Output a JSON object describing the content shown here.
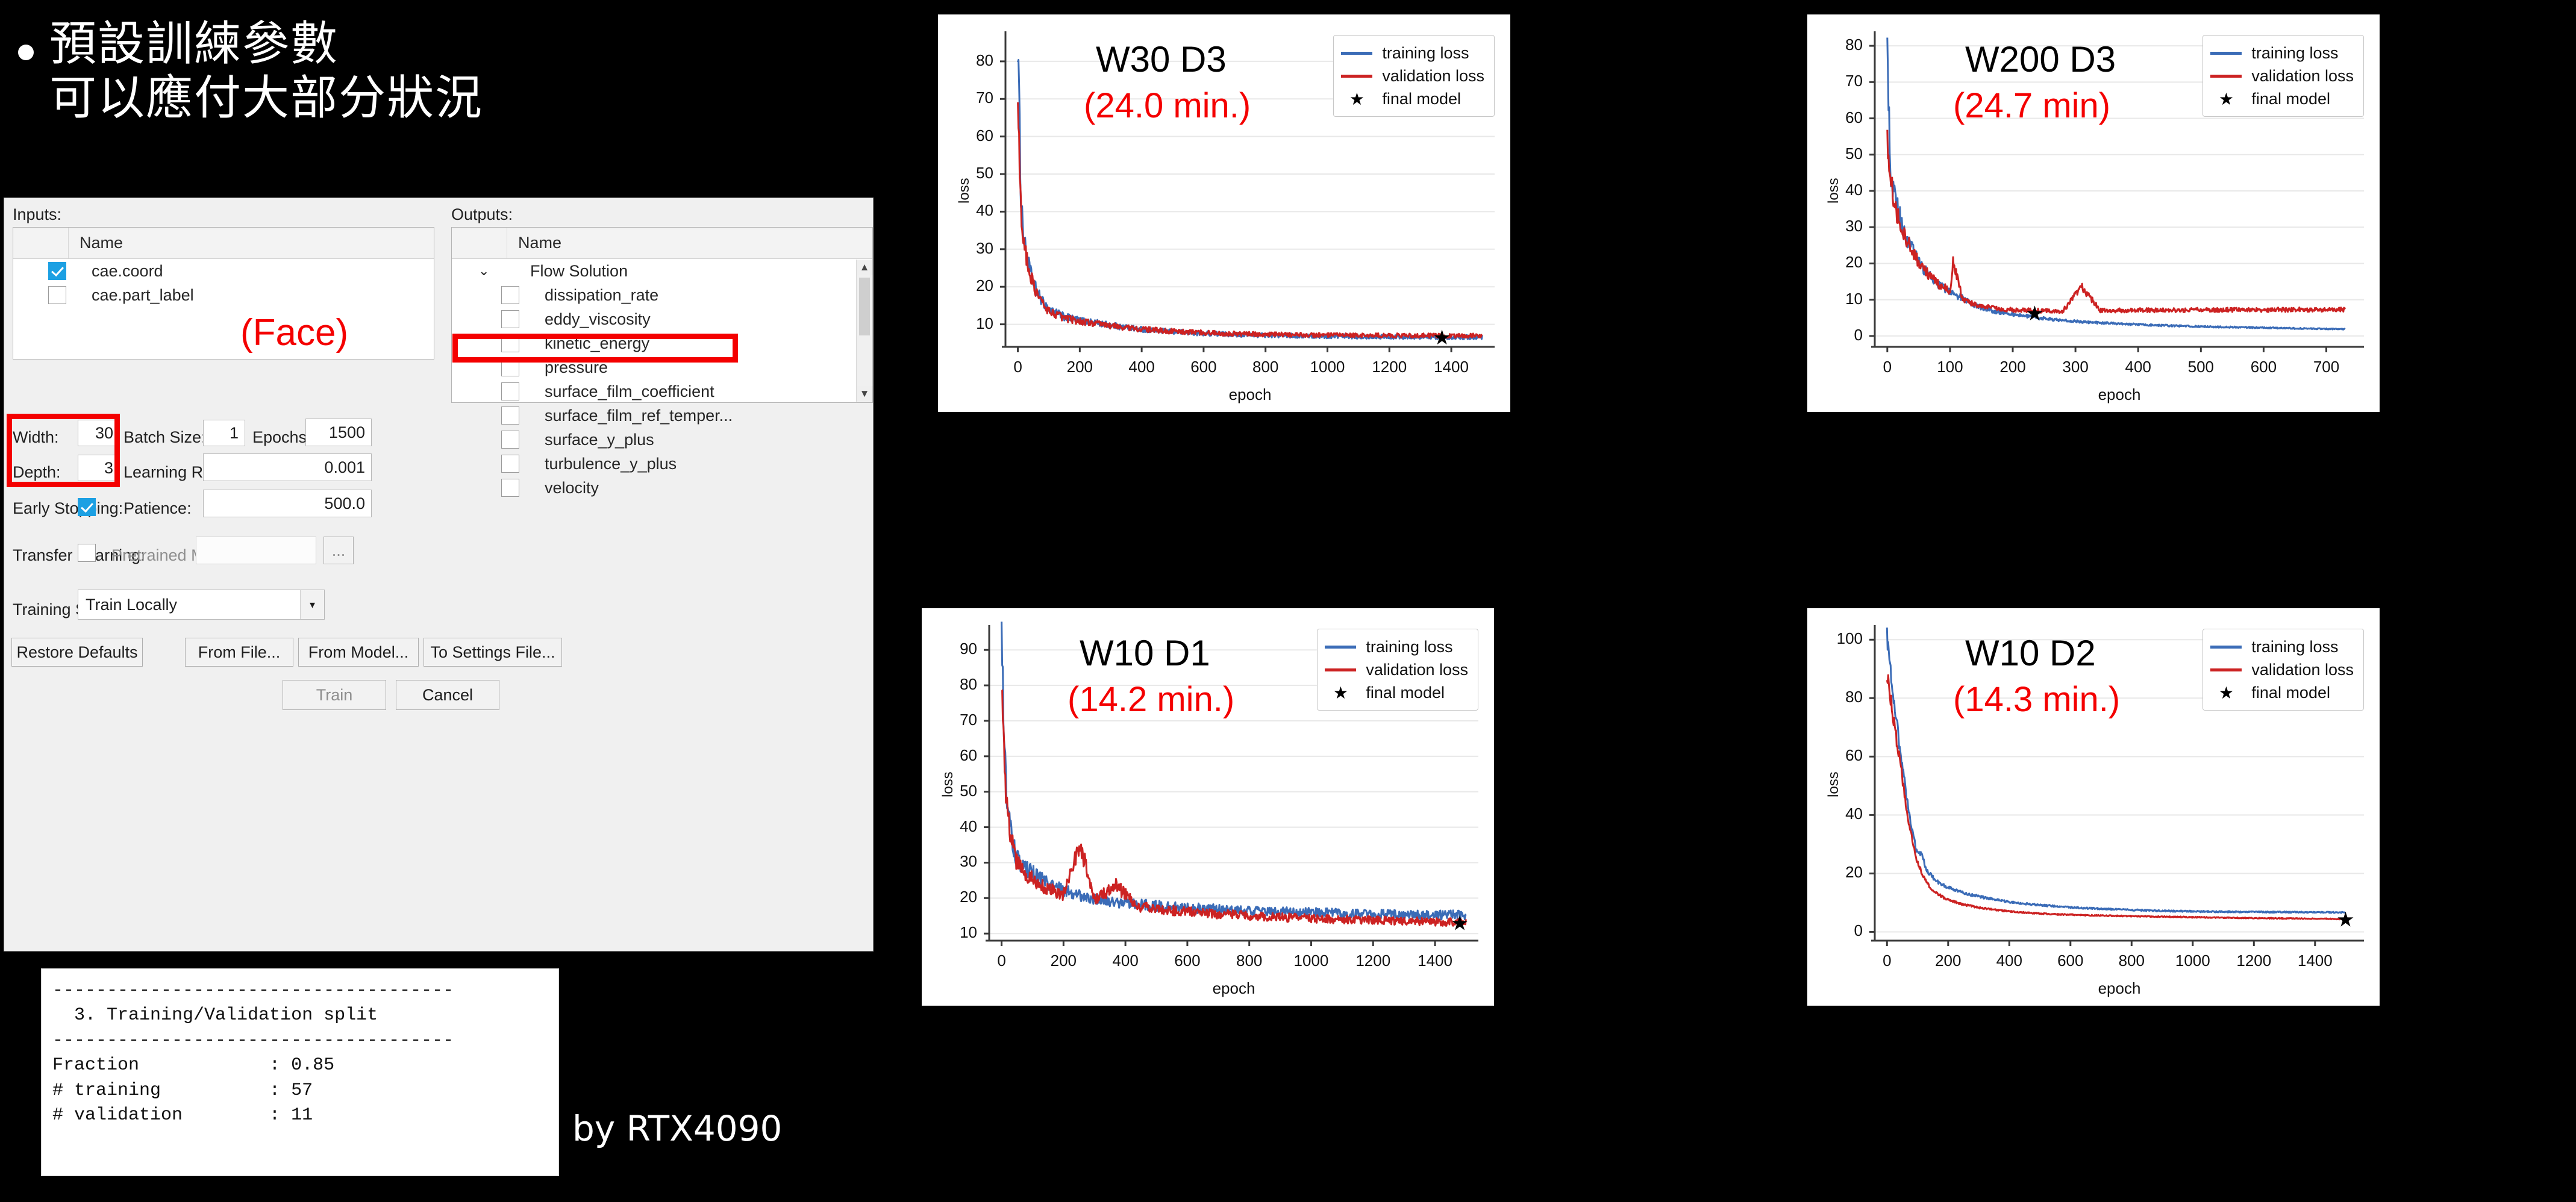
{
  "slide": {
    "bullet_lines": [
      "預設訓練參數",
      "可以應付大部分狀況"
    ],
    "by_gpu": "by RTX4090"
  },
  "dialog": {
    "inputs_label": "Inputs:",
    "outputs_label": "Outputs:",
    "column_header_name": "Name",
    "inputs": [
      {
        "name": "cae.coord",
        "checked": true
      },
      {
        "name": "cae.part_label",
        "checked": false
      }
    ],
    "outputs_group": "Flow Solution",
    "outputs": [
      {
        "name": "dissipation_rate",
        "checked": false
      },
      {
        "name": "eddy_viscosity",
        "checked": false
      },
      {
        "name": "kinetic_energy",
        "checked": false
      },
      {
        "name": "pressure",
        "checked": false
      },
      {
        "name": "surface_film_coefficient",
        "checked": false
      },
      {
        "name": "surface_film_ref_temper...",
        "checked": false
      },
      {
        "name": "surface_y_plus",
        "checked": false
      },
      {
        "name": "turbulence_y_plus",
        "checked": false
      },
      {
        "name": "velocity",
        "checked": false
      }
    ],
    "face_annotation": "(Face)",
    "fields": {
      "width_label": "Width:",
      "width_value": "30",
      "depth_label": "Depth:",
      "depth_value": "3",
      "batch_size_label": "Batch Size:",
      "batch_size_value": "1",
      "epochs_label": "Epochs:",
      "epochs_value": "1500",
      "learning_rate_label": "Learning Rate:",
      "learning_rate_value": "0.001",
      "early_stopping_label": "Early Stopping:",
      "early_stopping_checked": true,
      "patience_label": "Patience:",
      "patience_value": "500.0",
      "transfer_learning_label": "Transfer Learning:",
      "transfer_learning_checked": false,
      "pretrained_model_path_label": "Pretrained Model Path:",
      "pretrained_model_path_value": "",
      "browse_label": "...",
      "training_script_label": "Training Script:",
      "training_script_value": "Train Locally"
    },
    "buttons": {
      "restore_defaults": "Restore Defaults",
      "from_file": "From File...",
      "from_model": "From Model...",
      "to_settings_file": "To Settings File...",
      "train": "Train",
      "cancel": "Cancel"
    }
  },
  "console": {
    "lines": [
      "-------------------------------------",
      "  3. Training/Validation split",
      "-------------------------------------",
      "Fraction            : 0.85",
      "# training          : 57",
      "# validation        : 11"
    ]
  },
  "colors": {
    "training_loss": "#3b6cb7",
    "validation_loss": "#cc2222",
    "annotation_red": "#f40000",
    "final_model": "#000000"
  },
  "chart_data": [
    {
      "id": "w30d3",
      "type": "line",
      "title": "W30 D3",
      "time_label": "(24.0 min.)",
      "xlabel": "epoch",
      "ylabel": "loss",
      "xticks": [
        0,
        200,
        400,
        600,
        800,
        1000,
        1200,
        1400
      ],
      "yticks": [
        10,
        20,
        30,
        40,
        50,
        60,
        70,
        80
      ],
      "xlim": [
        -40,
        1540
      ],
      "ylim": [
        4,
        88
      ],
      "grid": true,
      "legend_position": "top-right",
      "legend": [
        "training loss",
        "validation loss",
        "final model"
      ],
      "final_model_point": {
        "epoch": 1370,
        "loss": 6.6
      },
      "series": [
        {
          "name": "training loss",
          "x": [
            0,
            10,
            20,
            40,
            60,
            80,
            100,
            150,
            200,
            260,
            330,
            400,
            470,
            530,
            600,
            700,
            800,
            900,
            1000,
            1100,
            1200,
            1300,
            1400,
            1500
          ],
          "values": [
            86,
            44,
            32,
            24,
            19,
            16,
            14,
            12,
            11,
            10.3,
            9.4,
            8.7,
            8.2,
            7.9,
            7.6,
            7.3,
            7.1,
            6.95,
            6.85,
            6.75,
            6.7,
            6.65,
            6.6,
            6.6
          ]
        },
        {
          "name": "validation loss",
          "x": [
            0,
            10,
            20,
            40,
            60,
            80,
            100,
            150,
            200,
            260,
            330,
            400,
            470,
            530,
            600,
            700,
            800,
            900,
            1000,
            1100,
            1200,
            1300,
            1400,
            1500
          ],
          "values": [
            68,
            41,
            31,
            23,
            18.5,
            15.5,
            13.5,
            11.7,
            10.8,
            10.1,
            9.3,
            8.7,
            8.3,
            8.0,
            7.8,
            7.5,
            7.3,
            7.2,
            7.1,
            7.05,
            7.0,
            7.0,
            6.95,
            7.0
          ]
        }
      ]
    },
    {
      "id": "w200d3",
      "type": "line",
      "title": "W200 D3",
      "time_label": "(24.7 min)",
      "xlabel": "epoch",
      "ylabel": "loss",
      "xticks": [
        0,
        100,
        200,
        300,
        400,
        500,
        600,
        700
      ],
      "yticks": [
        0,
        10,
        20,
        30,
        40,
        50,
        60,
        70,
        80
      ],
      "xlim": [
        -20,
        760
      ],
      "ylim": [
        -3,
        84
      ],
      "grid": true,
      "legend_position": "top-right",
      "legend": [
        "training loss",
        "validation loss",
        "final model"
      ],
      "final_model_point": {
        "epoch": 235,
        "loss": 6.3
      },
      "series": [
        {
          "name": "training loss",
          "x": [
            0,
            5,
            12,
            20,
            30,
            45,
            60,
            80,
            100,
            120,
            140,
            170,
            200,
            240,
            280,
            320,
            380,
            440,
            500,
            560,
            620,
            680,
            730
          ],
          "values": [
            80.5,
            45,
            38,
            33,
            27,
            22,
            18,
            14.5,
            12,
            10.5,
            8.4,
            6.8,
            6.0,
            5.0,
            4.3,
            3.8,
            3.3,
            2.9,
            2.6,
            2.4,
            2.2,
            2.0,
            1.9
          ]
        },
        {
          "name": "validation loss",
          "x": [
            0,
            5,
            12,
            20,
            30,
            45,
            60,
            80,
            100,
            105,
            120,
            140,
            170,
            200,
            240,
            280,
            310,
            340,
            400,
            460,
            520,
            600,
            680,
            730
          ],
          "values": [
            53,
            44,
            35,
            32,
            27,
            21.5,
            18,
            14.5,
            12.5,
            20.5,
            10,
            8.6,
            7.6,
            7.2,
            7.0,
            6.9,
            13.5,
            7.0,
            7.1,
            7.1,
            7.2,
            7.2,
            7.3,
            7.3
          ]
        }
      ]
    },
    {
      "id": "w10d1",
      "type": "line",
      "title": "W10 D1",
      "time_label": "(14.2 min.)",
      "xlabel": "epoch",
      "ylabel": "loss",
      "xticks": [
        0,
        200,
        400,
        600,
        800,
        1000,
        1200,
        1400
      ],
      "yticks": [
        10,
        20,
        30,
        40,
        50,
        60,
        70,
        80,
        90
      ],
      "xlim": [
        -40,
        1540
      ],
      "ylim": [
        8,
        97
      ],
      "grid": true,
      "legend_position": "top-right",
      "legend": [
        "training loss",
        "validation loss",
        "final model"
      ],
      "final_model_point": {
        "epoch": 1480,
        "loss": 13.0
      },
      "series": [
        {
          "name": "training loss",
          "x": [
            0,
            10,
            20,
            35,
            50,
            70,
            100,
            150,
            200,
            260,
            330,
            400,
            500,
            600,
            700,
            800,
            900,
            1000,
            1100,
            1200,
            1300,
            1400,
            1500
          ],
          "values": [
            94.5,
            60,
            45,
            36,
            31,
            28.5,
            27,
            24,
            22,
            20.5,
            19.5,
            18.6,
            17.8,
            17.2,
            16.8,
            16.4,
            16.1,
            15.9,
            15.7,
            15.5,
            15.4,
            15.3,
            15.2
          ]
        },
        {
          "name": "validation loss",
          "x": [
            0,
            10,
            20,
            35,
            50,
            70,
            100,
            150,
            200,
            255,
            300,
            370,
            440,
            520,
            620,
            720,
            830,
            950,
            1060,
            1180,
            1300,
            1420,
            1500
          ],
          "values": [
            77.5,
            55,
            43,
            35,
            30,
            27.5,
            25.5,
            22.5,
            21,
            35,
            19.3,
            23.5,
            17.6,
            16.8,
            16.0,
            15.4,
            14.9,
            14.4,
            14.1,
            13.8,
            13.6,
            13.3,
            13.1
          ]
        }
      ]
    },
    {
      "id": "w10d2",
      "type": "line",
      "title": "W10 D2",
      "time_label": "(14.3 min.)",
      "xlabel": "epoch",
      "ylabel": "loss",
      "xticks": [
        0,
        200,
        400,
        600,
        800,
        1000,
        1200,
        1400
      ],
      "yticks": [
        0,
        20,
        40,
        60,
        80,
        100
      ],
      "xlim": [
        -40,
        1560
      ],
      "ylim": [
        -3,
        105
      ],
      "grid": true,
      "legend_position": "top-right",
      "legend": [
        "training loss",
        "validation loss",
        "final model"
      ],
      "final_model_point": {
        "epoch": 1500,
        "loss": 4.3
      },
      "series": [
        {
          "name": "training loss",
          "x": [
            0,
            20,
            45,
            70,
            95,
            115,
            130,
            160,
            200,
            260,
            330,
            400,
            500,
            600,
            700,
            800,
            900,
            1000,
            1100,
            1250,
            1400,
            1500
          ],
          "values": [
            101,
            82,
            60,
            42,
            28,
            26,
            21,
            17.5,
            15.2,
            13,
            11.5,
            10.2,
            9.2,
            8.4,
            7.9,
            7.5,
            7.2,
            7.0,
            6.9,
            6.8,
            6.7,
            6.6
          ]
        },
        {
          "name": "validation loss",
          "x": [
            0,
            20,
            45,
            70,
            95,
            120,
            150,
            190,
            240,
            300,
            380,
            460,
            560,
            660,
            780,
            900,
            1020,
            1150,
            1300,
            1420,
            1500
          ],
          "values": [
            88,
            74,
            56,
            38,
            25,
            18.5,
            14,
            11.5,
            9.6,
            8.3,
            7.2,
            6.5,
            6.0,
            5.7,
            5.4,
            5.2,
            5.0,
            4.8,
            4.6,
            4.5,
            4.4
          ]
        }
      ]
    }
  ]
}
